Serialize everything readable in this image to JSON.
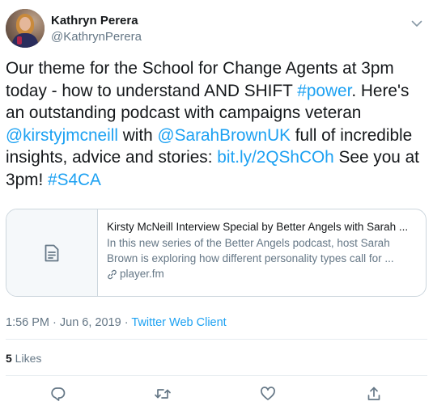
{
  "author": {
    "name": "Kathryn Perera",
    "handle": "@KathrynPerera"
  },
  "tweet": {
    "segments": [
      {
        "text": "Our theme for the School for Change Agents at 3pm today - how to understand AND SHIFT ",
        "link": false
      },
      {
        "text": "#power",
        "link": true
      },
      {
        "text": ". Here's an outstanding podcast with campaigns veteran ",
        "link": false
      },
      {
        "text": "@kirstyjmcneill",
        "link": true
      },
      {
        "text": " with ",
        "link": false
      },
      {
        "text": "@SarahBrownUK",
        "link": true
      },
      {
        "text": " full of incredible insights, advice and stories: ",
        "link": false
      },
      {
        "text": "bit.ly/2QShCOh",
        "link": true
      },
      {
        "text": " See you at 3pm! ",
        "link": false
      },
      {
        "text": "#S4CA",
        "link": true
      }
    ]
  },
  "card": {
    "title": "Kirsty McNeill Interview Special by Better Angels with Sarah ...",
    "description_line1": "In this new series of the Better Angels podcast, host Sarah",
    "description_line2": "Brown is exploring how different personality types call for ...",
    "domain": "player.fm"
  },
  "meta": {
    "time": "1:56 PM",
    "separator1": " · ",
    "date": "Jun 6, 2019",
    "separator2": " · ",
    "client": "Twitter Web Client"
  },
  "likes": {
    "count": "5",
    "label": " Likes"
  },
  "icons": {
    "more": "chevron-down-icon",
    "card_thumb": "document-icon",
    "domain_link": "link-icon",
    "reply": "reply-icon",
    "retweet": "retweet-icon",
    "like": "heart-icon",
    "share": "share-icon"
  },
  "colors": {
    "link": "#1da1f2",
    "secondary_text": "#657786",
    "primary_text": "#14171a",
    "border": "#ccd6dd"
  }
}
